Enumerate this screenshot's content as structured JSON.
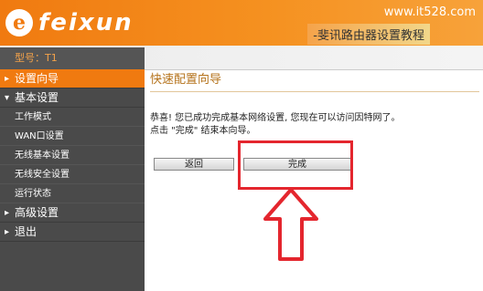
{
  "header": {
    "logo_text": "feixun",
    "logo_mark": "e",
    "watermark": "www.it528.com",
    "tutorial": "-斐讯路由器设置教程"
  },
  "model": "型号：T1",
  "sidebar": {
    "items": [
      {
        "label": "设置向导",
        "active": true,
        "arrow": "▸"
      },
      {
        "label": "基本设置",
        "active": false,
        "arrow": "▾"
      }
    ],
    "subitems": [
      "工作模式",
      "WAN口设置",
      "无线基本设置",
      "无线安全设置",
      "运行状态"
    ],
    "bottom_items": [
      {
        "label": "高级设置",
        "arrow": "▸"
      },
      {
        "label": "退出",
        "arrow": "▸"
      }
    ]
  },
  "main": {
    "title": "快速配置向导",
    "message_line1": "恭喜! 您已成功完成基本网络设置, 您现在可以访问因特网了。",
    "message_line2": "点击 \"完成\" 结束本向导。",
    "back_label": "返回",
    "done_label": "完成"
  },
  "colors": {
    "brand": "#f07a10",
    "sidebar": "#4a4a4a",
    "highlight": "#e4262e"
  }
}
